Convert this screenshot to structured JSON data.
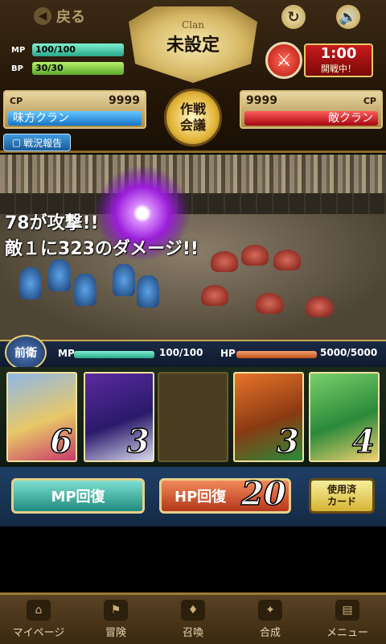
{
  "header": {
    "back_label": "戻る",
    "back_icon": "back-arrow-icon",
    "reload_icon": "reload-icon",
    "sound_icon": "speaker-icon",
    "mp": {
      "tag": "MP",
      "value": "100/100",
      "fraction": 1.0
    },
    "bp": {
      "tag": "BP",
      "value": "30/30",
      "fraction": 1.0
    },
    "clan_label": "Clan",
    "clan_name": "未設定",
    "timer": "1:00",
    "timer_status": "開戦中！",
    "battle_icon": "crossed-swords-icon"
  },
  "cp": {
    "ally": {
      "tag": "CP",
      "value": "9999",
      "name": "味方クラン"
    },
    "enemy": {
      "tag": "CP",
      "value": "9999",
      "name": "敵クラン"
    }
  },
  "strategy_button": {
    "line1": "作戦",
    "line2": "会議"
  },
  "report_button": "戦況報告",
  "battle": {
    "message_line1": "78が攻撃!!",
    "message_line2": "敵１に323のダメージ!!"
  },
  "status": {
    "position": "前衛",
    "mp_tag": "MP",
    "mp_value": "100/100",
    "mp_fraction": 1.0,
    "hp_tag": "HP",
    "hp_value": "5000/5000",
    "hp_fraction": 1.0
  },
  "cards": [
    {
      "number": "6",
      "colors": [
        "#8fb8e8",
        "#e8c868",
        "#c83a6a"
      ]
    },
    {
      "number": "3",
      "colors": [
        "#5a2aa0",
        "#2a1a6a",
        "#d9d9f0"
      ]
    },
    {
      "number": "",
      "empty": true
    },
    {
      "number": "3",
      "colors": [
        "#e8742a",
        "#8a3a12",
        "#2a8a3a"
      ]
    },
    {
      "number": "4",
      "colors": [
        "#7ad06a",
        "#2a8a3a",
        "#f0d070"
      ]
    }
  ],
  "actions": {
    "mp_recover": "MP回復",
    "hp_recover": "HP回復",
    "hp_count": "20",
    "used_line1": "使用済",
    "used_line2": "カード"
  },
  "nav": [
    {
      "label": "マイページ",
      "icon": "house-icon"
    },
    {
      "label": "冒険",
      "icon": "flag-icon"
    },
    {
      "label": "召喚",
      "icon": "summon-icon"
    },
    {
      "label": "合成",
      "icon": "fusion-icon"
    },
    {
      "label": "メニュー",
      "icon": "book-icon"
    }
  ]
}
